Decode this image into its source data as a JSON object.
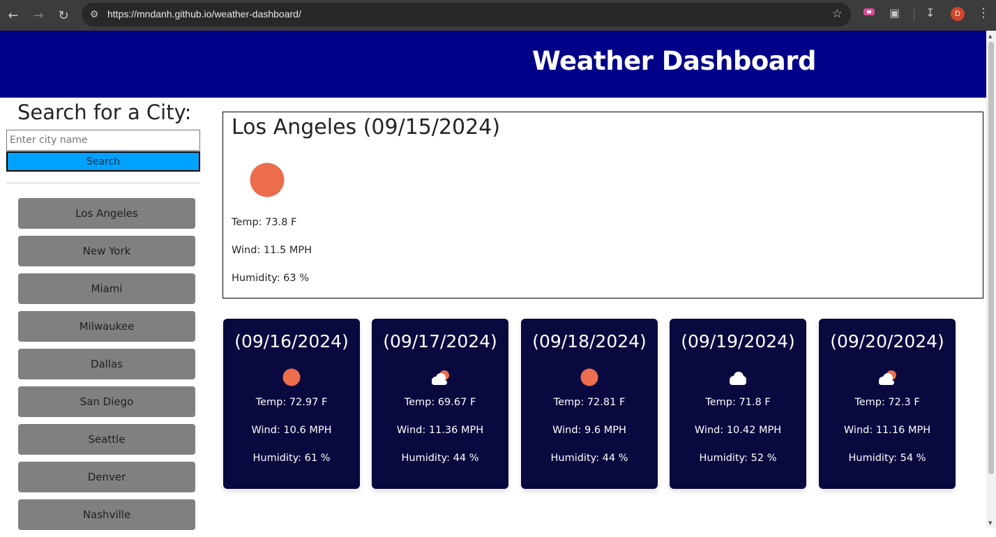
{
  "browser": {
    "url": "https://mndanh.github.io/weather-dashboard/",
    "profile_initial": "D"
  },
  "header": {
    "title": "Weather Dashboard"
  },
  "search": {
    "heading": "Search for a City:",
    "placeholder": "Enter city name",
    "button_label": "Search"
  },
  "history": [
    "Los Angeles",
    "New York",
    "Miami",
    "Milwaukee",
    "Dallas",
    "San Diego",
    "Seattle",
    "Denver",
    "Nashville"
  ],
  "current": {
    "title": "Los Angeles (09/15/2024)",
    "icon": "sun-icon",
    "temp": "Temp: 73.8 F",
    "wind": "Wind: 11.5 MPH",
    "humidity": "Humidity: 63 %"
  },
  "forecast": [
    {
      "date": "(09/16/2024)",
      "icon": "sun-icon",
      "temp": "Temp: 72.97 F",
      "wind": "Wind: 10.6 MPH",
      "humidity": "Humidity: 61 %"
    },
    {
      "date": "(09/17/2024)",
      "icon": "partly-cloudy-icon",
      "temp": "Temp: 69.67 F",
      "wind": "Wind: 11.36 MPH",
      "humidity": "Humidity: 44 %"
    },
    {
      "date": "(09/18/2024)",
      "icon": "sun-icon",
      "temp": "Temp: 72.81 F",
      "wind": "Wind: 9.6 MPH",
      "humidity": "Humidity: 44 %"
    },
    {
      "date": "(09/19/2024)",
      "icon": "cloud-icon",
      "temp": "Temp: 71.8 F",
      "wind": "Wind: 10.42 MPH",
      "humidity": "Humidity: 52 %"
    },
    {
      "date": "(09/20/2024)",
      "icon": "partly-cloudy-icon",
      "temp": "Temp: 72.3 F",
      "wind": "Wind: 11.16 MPH",
      "humidity": "Humidity: 54 %"
    }
  ],
  "colors": {
    "header_bg": "#000088",
    "search_button": "#00a2ff",
    "history_button": "#808080",
    "forecast_card": "#09093f",
    "sun": "#ec6e4c"
  }
}
